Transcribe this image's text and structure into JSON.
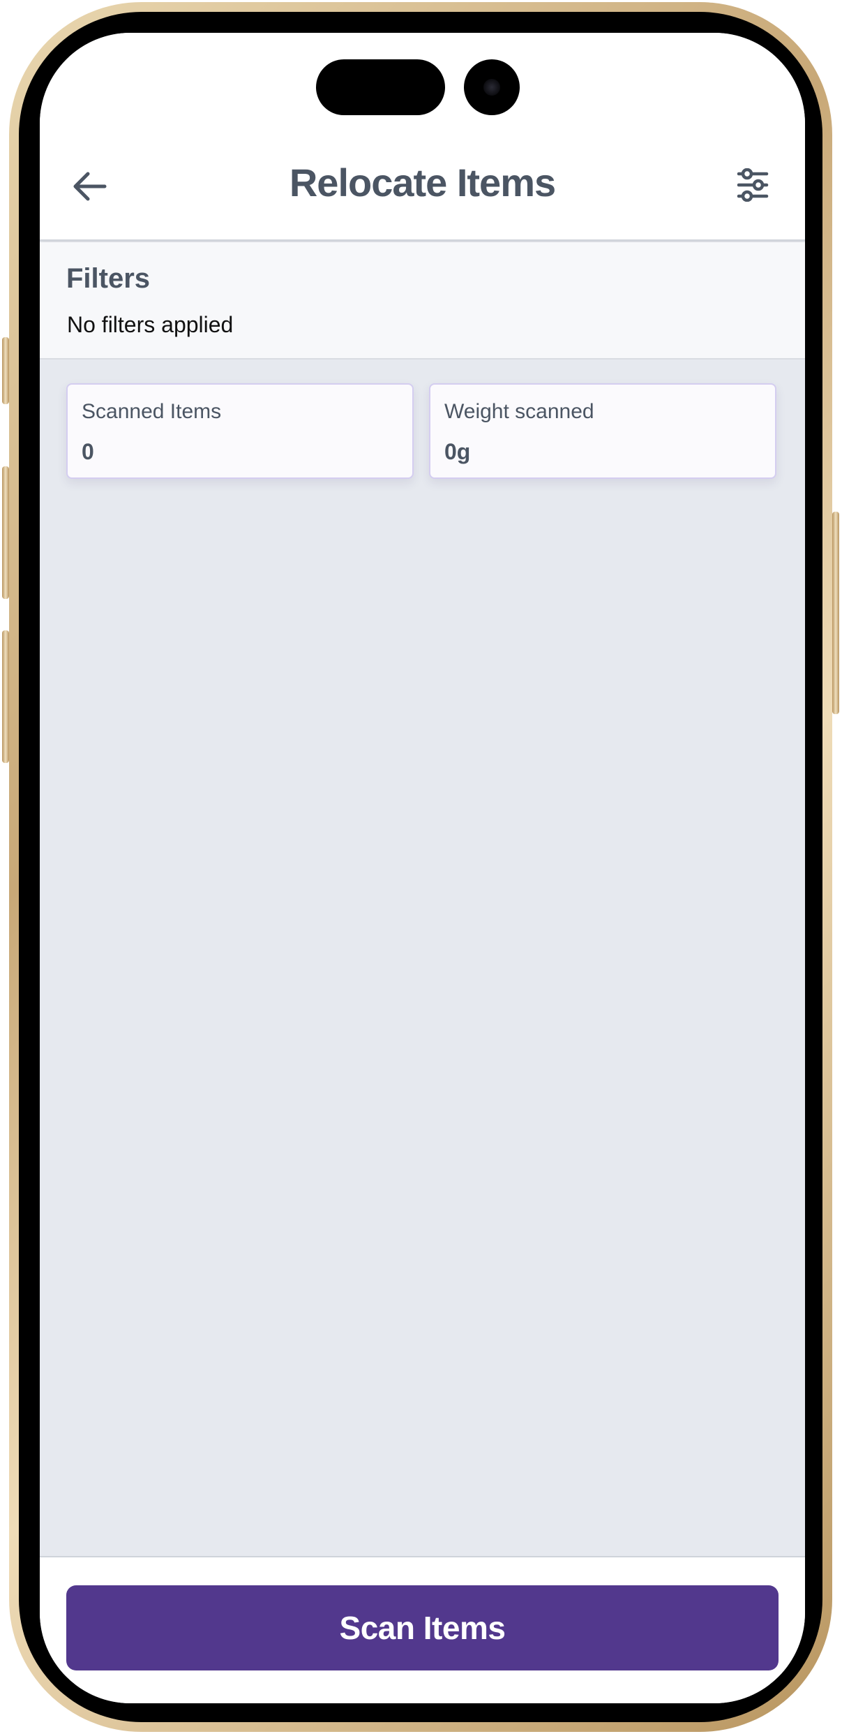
{
  "header": {
    "title": "Relocate Items",
    "back_icon": "arrow-left-icon",
    "filter_icon": "sliders-icon"
  },
  "filters": {
    "heading": "Filters",
    "status": "No filters applied"
  },
  "stats": [
    {
      "label": "Scanned Items",
      "value": "0"
    },
    {
      "label": "Weight scanned",
      "value": "0g"
    }
  ],
  "footer": {
    "scan_label": "Scan Items"
  },
  "colors": {
    "primary": "#52388d",
    "text_muted": "#4b5563",
    "background": "#e6e9ef",
    "device_frame": "#c8a877"
  }
}
